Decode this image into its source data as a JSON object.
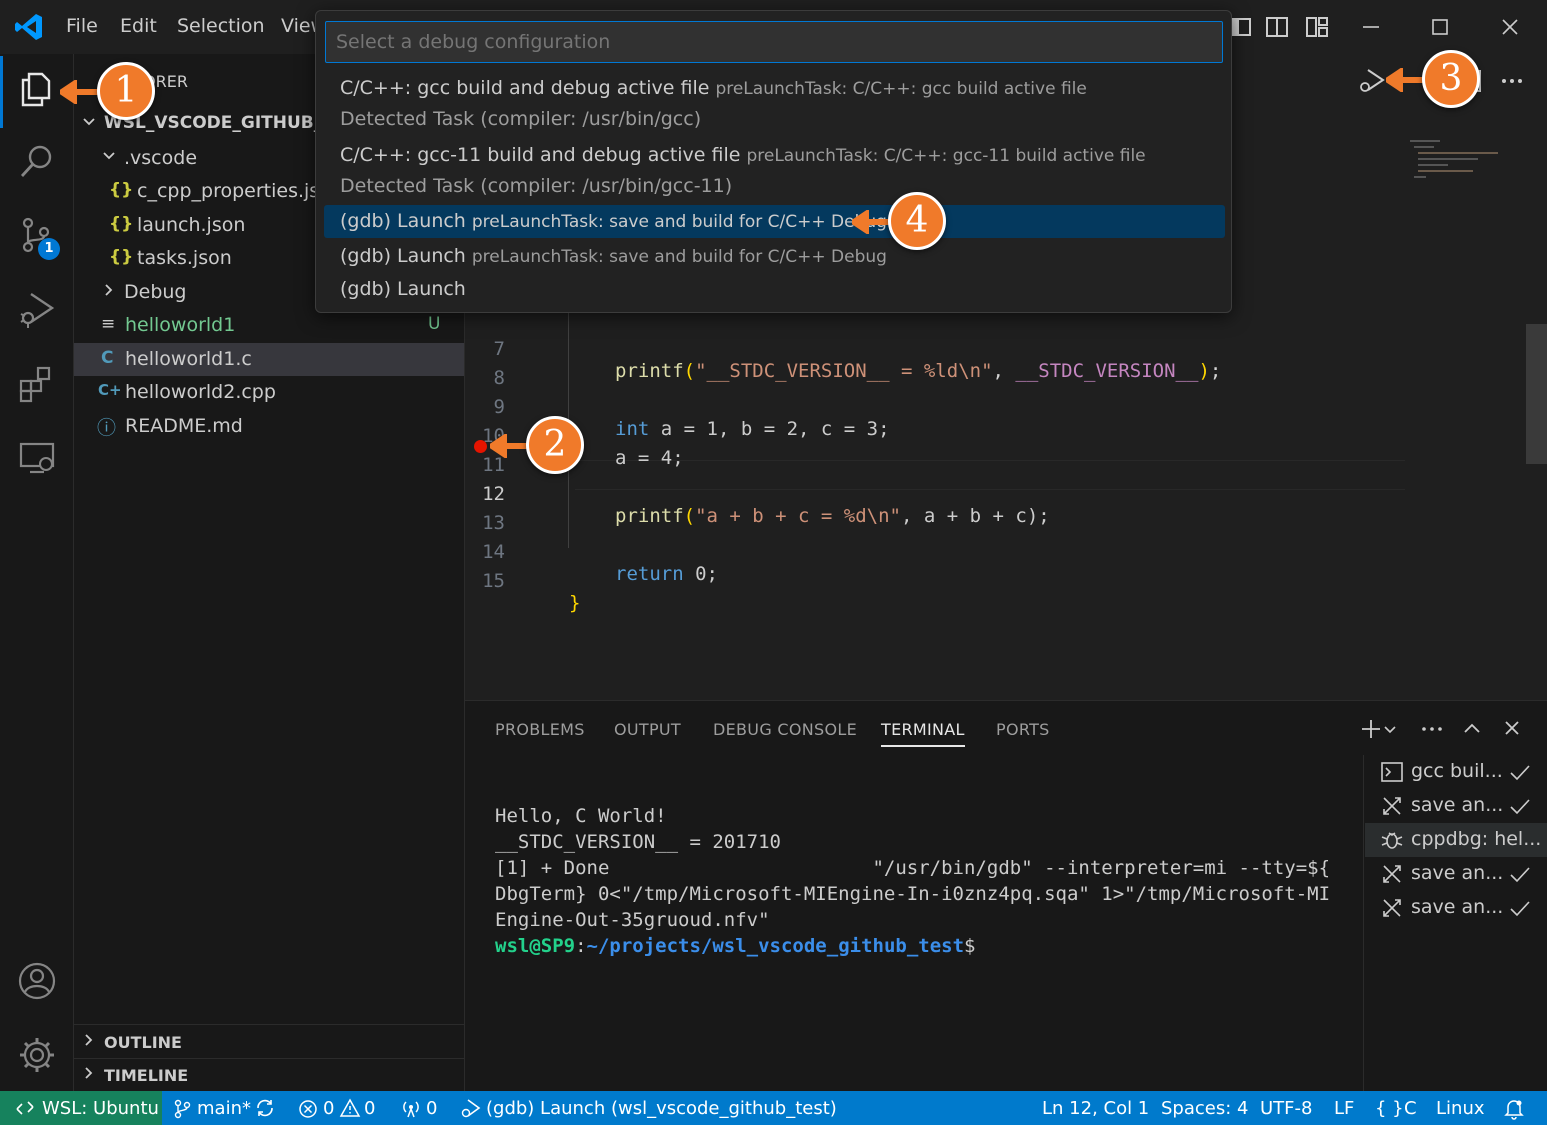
{
  "titlebar": {
    "menu": [
      "File",
      "Edit",
      "Selection",
      "View"
    ]
  },
  "sidebar": {
    "explorer_title": "EXPLORER",
    "root_folder": "WSL_VSCODE_GITHUB_TEST",
    "items": [
      {
        "label": ".vscode",
        "icon": "folder-open-chevron"
      },
      {
        "label": "c_cpp_properties.json",
        "icon": "json-braces-icon",
        "glyph": "{}"
      },
      {
        "label": "launch.json",
        "icon": "json-braces-icon",
        "glyph": "{}"
      },
      {
        "label": "tasks.json",
        "icon": "json-braces-icon",
        "glyph": "{}"
      },
      {
        "label": "Debug",
        "icon": "folder-closed-chevron"
      },
      {
        "label": "helloworld1",
        "icon": "binary-file-icon",
        "glyph": "≡",
        "badge": "U"
      },
      {
        "label": "helloworld1.c",
        "icon": "c-file-icon",
        "glyph": "C"
      },
      {
        "label": "helloworld2.cpp",
        "icon": "cpp-file-icon",
        "glyph": "C+"
      },
      {
        "label": "README.md",
        "icon": "info-icon",
        "glyph": "ⓘ"
      }
    ],
    "outline": "OUTLINE",
    "timeline": "TIMELINE",
    "scm_badge": "1"
  },
  "quickpick": {
    "placeholder": "Select a debug configuration",
    "items": [
      {
        "label": "C/C++: gcc build and debug active file",
        "desc": "preLaunchTask: C/C++: gcc build active file"
      },
      {
        "label": "",
        "desc": "Detected Task (compiler: /usr/bin/gcc)"
      },
      {
        "label": "C/C++: gcc-11 build and debug active file",
        "desc": "preLaunchTask: C/C++: gcc-11 build active file"
      },
      {
        "label": "",
        "desc": "Detected Task (compiler: /usr/bin/gcc-11)"
      },
      {
        "label": "(gdb) Launch",
        "desc": "preLaunchTask: save and build for C/C++ Debug",
        "selected": true
      },
      {
        "label": "(gdb) Launch",
        "desc": "preLaunchTask: save and build for C/C++ Debug"
      },
      {
        "label": "(gdb) Launch",
        "desc": ""
      }
    ]
  },
  "editor": {
    "lines": [
      {
        "n": "7"
      },
      {
        "n": "8"
      },
      {
        "n": "9"
      },
      {
        "n": "10"
      },
      {
        "n": "11"
      },
      {
        "n": "12"
      },
      {
        "n": "13"
      },
      {
        "n": "14"
      },
      {
        "n": "15"
      }
    ],
    "code": {
      "l7_fn": "printf",
      "l7_str1": "\"__STDC_VERSION__ = %ld\\n\"",
      "l7_mac": "__STDC_VERSION__",
      "l9_kw": "int",
      "l9_rest": " a = 1, b = 2, c = 3;",
      "l10": "a = 4;",
      "l12_fn": "printf",
      "l12_str": "\"a + b + c = %d\\n\"",
      "l12_rest": ", a + b + c);",
      "l14_kw": "return",
      "l14_rest": " 0;",
      "l15": "}"
    }
  },
  "panel": {
    "tabs": [
      "PROBLEMS",
      "OUTPUT",
      "DEBUG CONSOLE",
      "TERMINAL",
      "PORTS"
    ],
    "active_tab": "TERMINAL",
    "terminal_lines": [
      "Hello, C World!",
      "__STDC_VERSION__ = 201710",
      "[1] + Done                       \"/usr/bin/gdb\" --interpreter=mi --tty=${",
      "DbgTerm} 0<\"/tmp/Microsoft-MIEngine-In-i0znz4pq.sqa\" 1>\"/tmp/Microsoft-MI",
      "Engine-Out-35gruoud.nfv\""
    ],
    "prompt_user": "wsl@SP9",
    "prompt_sep": ":",
    "prompt_path": "~/projects/wsl_vscode_github_test",
    "prompt_end": "$",
    "terminals": [
      {
        "label": "gcc buil...",
        "icon": "terminal-icon",
        "check": true
      },
      {
        "label": "save an...",
        "icon": "tools-icon",
        "check": true
      },
      {
        "label": "cppdbg: hel...",
        "icon": "debug-icon",
        "check": false,
        "active": true
      },
      {
        "label": "save an...",
        "icon": "tools-icon",
        "check": true
      },
      {
        "label": "save an...",
        "icon": "tools-icon",
        "check": true
      }
    ]
  },
  "statusbar": {
    "remote": "WSL: Ubuntu",
    "branch": "main*",
    "errors": "0",
    "warnings": "0",
    "ports": "0",
    "debug_config": "(gdb) Launch (wsl_vscode_github_test)",
    "position": "Ln 12, Col 1",
    "spaces": "Spaces: 4",
    "encoding": "UTF-8",
    "eol": "LF",
    "language": "C",
    "platform": "Linux"
  },
  "callouts": [
    "1",
    "2",
    "3",
    "4"
  ],
  "colors": {
    "accent": "#0078d4",
    "statusbar": "#007acc",
    "remote": "#16825d",
    "callout": "#f07a2a",
    "breakpoint": "#e51400"
  }
}
